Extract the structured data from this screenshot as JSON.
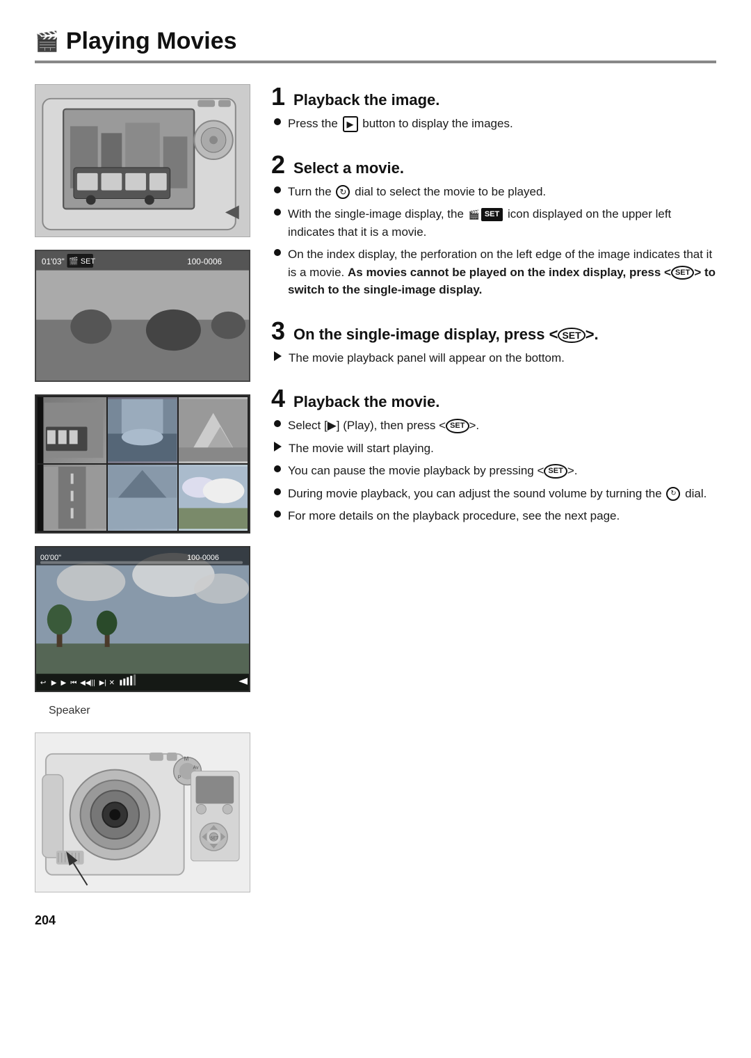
{
  "page": {
    "title": "Playing Movies",
    "title_icon": "🎬",
    "page_number": "204"
  },
  "steps": [
    {
      "number": "1",
      "title": "Playback the image.",
      "bullets": [
        {
          "type": "dot",
          "text": "Press the",
          "inline_icon": "playback_button",
          "text_after": " button to display the images."
        }
      ]
    },
    {
      "number": "2",
      "title": "Select a movie.",
      "bullets": [
        {
          "type": "dot",
          "text": "Turn the",
          "inline_icon": "dial",
          "text_after": " dial to select the movie to be played."
        },
        {
          "type": "dot",
          "text": "With the single-image display, the",
          "inline_icon": "movie_set_icon",
          "text_after": " icon displayed on the upper left indicates that it is a movie."
        },
        {
          "type": "dot",
          "text": "On the index display, the perforation on the left edge of the image indicates that it is a movie.",
          "bold_text": "As movies cannot be played on the index display, press <SET> to switch to the single-image display.",
          "text_after": ""
        }
      ]
    },
    {
      "number": "3",
      "title": "On the single-image display, press < SET >.",
      "title_type": "bold",
      "bullets": [
        {
          "type": "arrow",
          "text": "The movie playback panel will appear on the bottom."
        }
      ]
    },
    {
      "number": "4",
      "title": "Playback the movie.",
      "bullets": [
        {
          "type": "dot",
          "text": "Select [▶] (Play), then press <SET>."
        },
        {
          "type": "arrow",
          "text": "The movie will start playing."
        },
        {
          "type": "dot",
          "text": "You can pause the movie playback by pressing <SET>."
        },
        {
          "type": "dot",
          "text": "During movie playback, you can adjust the sound volume by turning the",
          "inline_icon": "dial2",
          "text_after": " dial."
        },
        {
          "type": "dot",
          "text": "For more details on the playback procedure, see the next page."
        }
      ]
    }
  ],
  "images": {
    "speaker_label": "Speaker"
  },
  "playback_bar_icons": [
    "↩",
    "▶",
    "▶▶",
    "⏮",
    "◀◀",
    "|||",
    "▶▶|",
    "✕",
    "🔊",
    "▲"
  ]
}
